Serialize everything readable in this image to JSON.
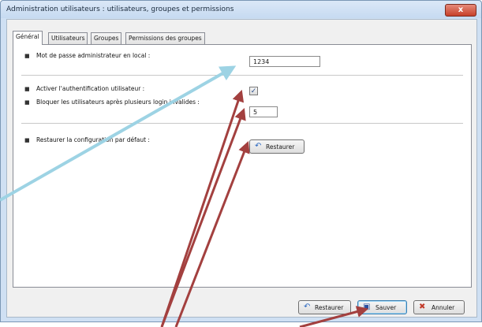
{
  "window": {
    "title": "Administration utilisateurs : utilisateurs, groupes et permissions",
    "close_label": "x"
  },
  "tabs": [
    {
      "label": "Général",
      "active": true
    },
    {
      "label": "Utilisateurs",
      "active": false
    },
    {
      "label": "Groupes",
      "active": false
    },
    {
      "label": "Permissions des groupes",
      "active": false
    }
  ],
  "general": {
    "admin_password_label": "Mot de passe administrateur en local :",
    "admin_password_value": "1234",
    "enable_auth_label": "Activer l'authentification utilisateur :",
    "enable_auth_checked": true,
    "block_users_label": "Bloquer les utilisateurs après plusieurs login invalides :",
    "block_users_value": "5",
    "restore_defaults_label": "Restaurer la configuration par défaut :",
    "restore_button_label": "Restaurer"
  },
  "footer": {
    "restore_label": "Restaurer",
    "save_label": "Sauver",
    "cancel_label": "Annuler"
  },
  "bullet_glyph": "■",
  "check_glyph": "✓",
  "colors": {
    "annotation_blue": "#9dd3e4",
    "annotation_red": "#a3403f"
  }
}
